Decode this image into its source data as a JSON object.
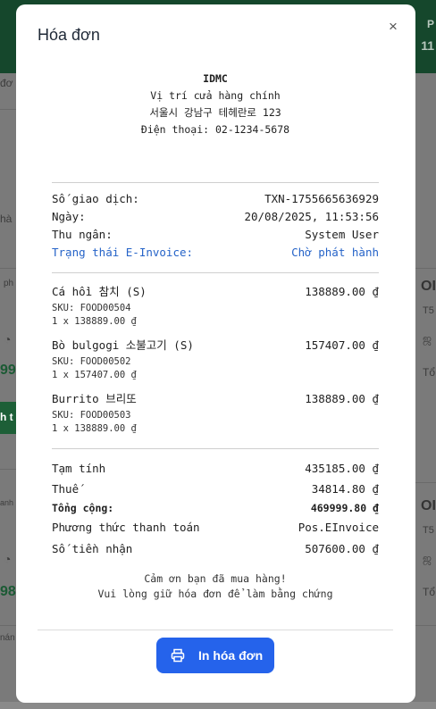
{
  "background": {
    "header_text_1": "P",
    "header_text_2": "11",
    "fragments": [
      "đơ",
      "hà",
      "ph",
      "99",
      "h t",
      "anh",
      "98",
      "nán",
      "OI",
      "T5",
      "OI",
      "T5"
    ]
  },
  "modal": {
    "title": "Hóa đơn",
    "close_glyph": "×",
    "print_button_label": "In hóa đơn"
  },
  "receipt": {
    "store_name": "IDMC",
    "store_subtitle": "Vị trí cửa hàng chính",
    "store_address": "서울시 강남구 테헤란로 123",
    "store_phone": "Điện thoại: 02-1234-5678",
    "info": {
      "transaction_label": "Số giao dịch:",
      "transaction_value": "TXN-1755665636929",
      "date_label": "Ngày:",
      "date_value": "20/08/2025, 11:53:56",
      "cashier_label": "Thu ngân:",
      "cashier_value": "System User",
      "einvoice_label": "Trạng thái E-Invoice:",
      "einvoice_value": "Chờ phát hành"
    },
    "items": [
      {
        "name": "Cá hồi 참치 (S)",
        "price": "138889.00 ₫",
        "sku": "SKU: FOOD00504",
        "qty_line": "1 x 138889.00 ₫"
      },
      {
        "name": "Bò bulgogi 소불고기 (S)",
        "price": "157407.00 ₫",
        "sku": "SKU: FOOD00502",
        "qty_line": "1 x 157407.00 ₫"
      },
      {
        "name": "Burrito 브리또",
        "price": "138889.00 ₫",
        "sku": "SKU: FOOD00503",
        "qty_line": "1 x 138889.00 ₫"
      }
    ],
    "totals": {
      "subtotal_label": "Tạm tính",
      "subtotal_value": "435185.00 ₫",
      "tax_label": "Thuế",
      "tax_value": "34814.80 ₫",
      "total_label": "Tổng cộng:",
      "total_value": "469999.80 ₫",
      "payment_label": "Phương thức thanh toán",
      "payment_value": "Pos.EInvoice",
      "received_label": "Số tiền nhận",
      "received_value": "507600.00 ₫"
    },
    "thanks_line_1": "Cảm ơn bạn đã mua hàng!",
    "thanks_line_2": "Vui lòng giữ hóa đơn để làm bằng chứng"
  },
  "colors": {
    "accent_blue": "#2563eb",
    "einvoice_blue": "#2563c8",
    "header_green": "#15472c"
  },
  "icons": {
    "close": "close-icon",
    "print": "printer-icon"
  }
}
